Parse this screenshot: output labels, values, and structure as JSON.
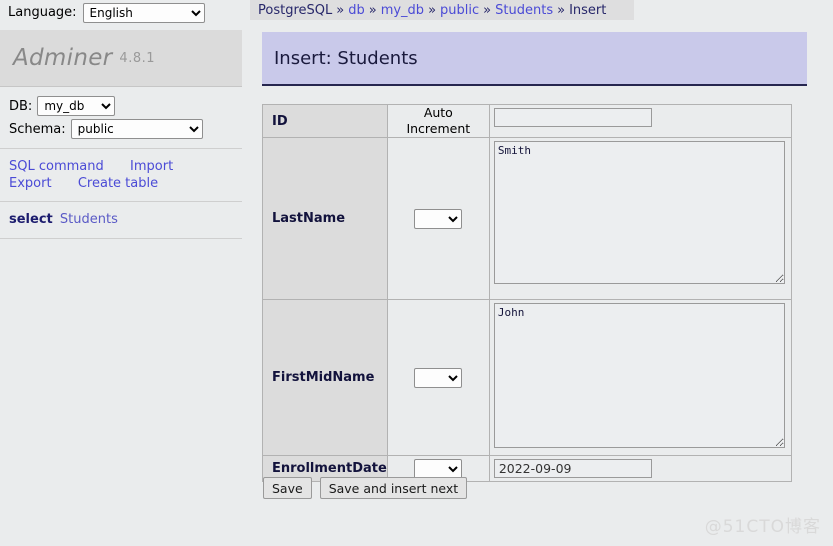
{
  "language_bar": {
    "label": "Language:",
    "selected": "English",
    "options": [
      "English"
    ]
  },
  "logo": {
    "name": "Adminer",
    "version": "4.8.1"
  },
  "sidebar": {
    "db": {
      "label": "DB:",
      "selected": "my_db",
      "options": [
        "my_db"
      ]
    },
    "schema": {
      "label": "Schema:",
      "selected": "public",
      "options": [
        "public"
      ]
    },
    "actions": [
      {
        "label": "SQL command",
        "name": "sql-command-link"
      },
      {
        "label": "Import",
        "name": "import-link"
      },
      {
        "label": "Export",
        "name": "export-link"
      },
      {
        "label": "Create table",
        "name": "create-table-link"
      }
    ],
    "select_row": {
      "keyword": "select",
      "table": "Students"
    }
  },
  "breadcrumb": {
    "separator": "»",
    "items": [
      {
        "label": "PostgreSQL",
        "link": false
      },
      {
        "label": "db",
        "link": true
      },
      {
        "label": "my_db",
        "link": true
      },
      {
        "label": "public",
        "link": true
      },
      {
        "label": "Students",
        "link": true
      },
      {
        "label": "Insert",
        "link": false
      }
    ]
  },
  "page": {
    "title": "Insert: Students"
  },
  "form": {
    "rows": [
      {
        "field": "ID",
        "function_text": "Auto Increment",
        "function_select": null,
        "control": "input",
        "value": "",
        "placeholder": ""
      },
      {
        "field": "LastName",
        "function_text": "",
        "function_select": "",
        "control": "textarea",
        "value": "Smith",
        "placeholder": ""
      },
      {
        "field": "FirstMidName",
        "function_text": "",
        "function_select": "",
        "control": "textarea",
        "value": "John",
        "placeholder": ""
      },
      {
        "field": "EnrollmentDate",
        "function_text": "",
        "function_select": "",
        "control": "input",
        "value": "2022-09-09",
        "placeholder": ""
      }
    ],
    "buttons": [
      {
        "label": "Save",
        "name": "save-button"
      },
      {
        "label": "Save and insert next",
        "name": "save-and-insert-next-button"
      }
    ]
  },
  "watermark": {
    "text": "@51CTO博客"
  },
  "colors": {
    "page_bg": "#eaeced",
    "title_bg": "#c9c9ea",
    "logo_bg": "#dbdbdb",
    "breadcrumb_bg": "#dededf",
    "link": "#4b4bd6",
    "field_header_bg": "#dcdcdc"
  }
}
